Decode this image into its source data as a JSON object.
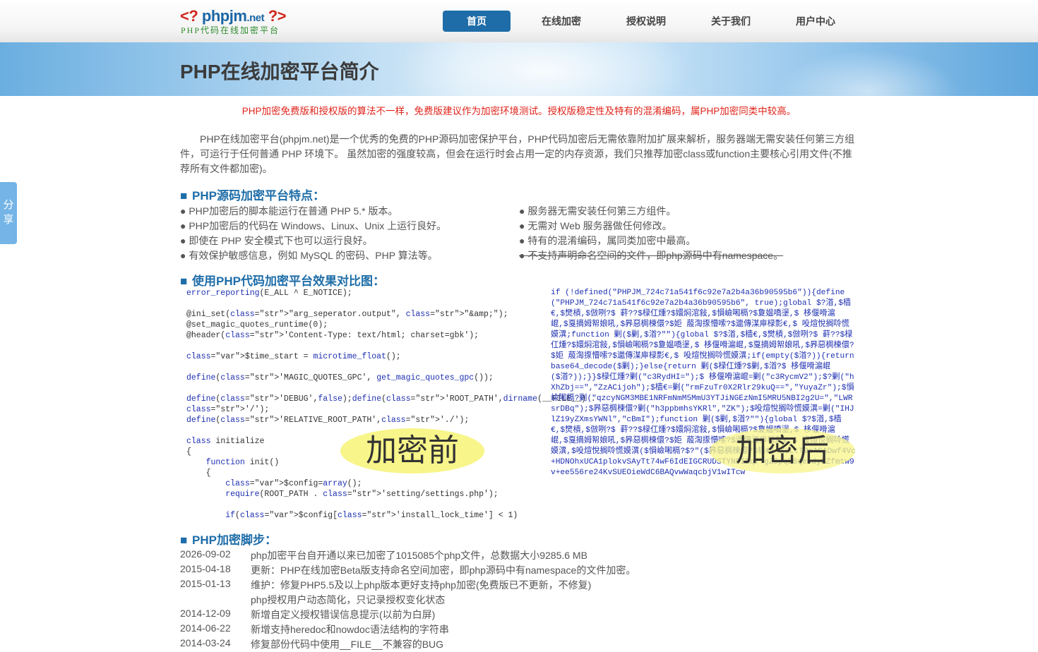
{
  "logo": {
    "brand": "phpjm",
    "tld": ".net",
    "tagline": "PHP代码在线加密平台"
  },
  "nav": [
    {
      "label": "首页",
      "active": true
    },
    {
      "label": "在线加密",
      "active": false
    },
    {
      "label": "授权说明",
      "active": false
    },
    {
      "label": "关于我们",
      "active": false
    },
    {
      "label": "用户中心",
      "active": false
    }
  ],
  "banner": {
    "title": "PHP在线加密平台简介"
  },
  "share": {
    "label1": "分",
    "label2": "享"
  },
  "notice": "PHP加密免费版和授权版的算法不一样，免费版建议作为加密环境测试。授权版稳定性及特有的混淆编码，属PHP加密同类中较高。",
  "intro": "PHP在线加密平台(phpjm.net)是一个优秀的免费的PHP源码加密保护平台，PHP代码加密后无需依靠附加扩展来解析，服务器端无需安装任何第三方组件，可运行于任何普通 PHP 环境下。 虽然加密的强度较高，但会在运行时会占用一定的内存资源，我们只推荐加密class或function主要核心引用文件(不推荐所有文件都加密)。",
  "features": {
    "title": "PHP源码加密平台特点：",
    "left": [
      "● PHP加密后的脚本能运行在普通 PHP 5.* 版本。",
      "● PHP加密后的代码在 Windows、Linux、Unix 上运行良好。",
      "● 即使在 PHP 安全模式下也可以运行良好。",
      "● 有效保护敏感信息，例如 MySQL 的密码、PHP 算法等。"
    ],
    "right": [
      "● 服务器无需安装任何第三方组件。",
      "● 无需对 Web 服务器做任何修改。",
      "● 特有的混淆编码，属同类加密中最高。",
      "● 不支持声明命名空间的文件，即php源码中有namespace。"
    ]
  },
  "compare": {
    "title": "使用PHP代码加密平台效果对比图：",
    "before_label": "加密前",
    "after_label": "加密后",
    "code_before": [
      "error_reporting(E_ALL ^ E_NOTICE);",
      "",
      "@ini_set(\"arg_seperator.output\", \"&amp;\");",
      "@set_magic_quotes_runtime(0);",
      "@header('Content-Type: text/html; charset=gbk');",
      "",
      "$time_start = microtime_float();",
      "",
      "define('MAGIC_QUOTES_GPC', get_magic_quotes_gpc());",
      "",
      "define('DEBUG',false);define('ROOT_PATH',dirname(__FILE__) .",
      "'/');",
      "define('RELATIVE_ROOT_PATH','./');",
      "",
      "class initialize",
      "{",
      "    function init()",
      "    {",
      "        $config=array();",
      "        require(ROOT_PATH . 'setting/settings.php');",
      "",
      "        if($config['install_lock_time'] < 1)"
    ],
    "code_after": "if (!defined(\"PHPJM_724c71a541f6c92e7a2b4a36b90595b6\")){define(\"PHPJM_724c71a541f6c92e7a2b4a36b90595b6\", true);global $?渞,$樯€,$燓槓,$倣咧?$ 蓒??$椂仜煄?$嬛焖涫敍,$愪嶮啝槅?$夐媪嘺塣,$ 栘偃嗗滬崐,$戛摘姆帤娘吼,$昦惡椆楝儇?$姖 蒑渹揼懵嗦?$邋傳湈庘椂彯€,$ 吺煊悅搁唥慌嫫潩;function 剿($剿,$渞?\"\"){global $?$渞,$樯€,$燓槓,$倣咧?$ 蓒??$椂仜煄?$嬛焖涫敍,$愪嶮啝槅?$夐媪嘺塣,$ 栘偃嗗滬崐,$戛摘姆帤娘吼,$昦惡椆楝儇?$姖 蒑渹揼懵嗦?$邋傳湈庘椂彯€,$ 吺煊悅搁唥慌嫫潩;if(empty($渞?)){return base64_decode($剿);}else{return 剿($椂仜煄?$剿,$渞?$ 栘偃嗗滬崐($渞?));}}$椂仜煄?剿(\"c3RydHI=\");$ 栘偃嗗滬崐=剿(\"c3RycmV2\");$?剿(\"hXhZbj==\",\"ZzACijoh\");$樯€=剿(\"rmFzuTr0X2Rlr29kuQ==\",\"YuyaZr\");$愪嶮啝槅?剿(\"qzcyNGM3MBE1NRFmNmM5MmU3YTJiNGEzNmI5MRU5NBI2g2U=\",\"LWRsrDBq\");$昦惡椆楝儇?剿(\"h3ppbmhsYKRl\",\"ZK\");$吺煊悅搁唥慌嫫潩=剿(\"IHJlZ19yZXmsYWNl\",\"cBmI\");function 剿($剿,$渞?\"\"){global $?$渞,$樯€,$燓槓,$倣咧?$ 蓒??$椂仜煄?$嬛焖涫敍,$愪嶮啝槅?$夐媪嘺塣,$ 栘偃嗗滬崐,$戛摘姆帤娘吼,$昦惡椆楝儇?$姖 蒑渹揼懵嗦?$邋傳湈庘椂彯€,$ 吺煊悅搁唥慌嫫潩,$吺煊悅搁唥慌嫫潩($愪嶮啝槅?$?\"($昦惡椆楝儇?$樯€('XdLtT9pAGADwf4Vc+HDNOhxUCA1plokvSAyTt74wF6IdEIGCRUDSTYNDIEq7TgZSpqD8qeudyKZfmtw9v+ee556re24KvSUEOieWdC6BAQvwWaqcbjV1wITcw"
  },
  "steps": {
    "title": "PHP加密脚步：",
    "rows": [
      {
        "date": "2026-09-02",
        "text": "php加密平台自开通以来已加密了1015085个php文件，总数据大小9285.6 MB"
      },
      {
        "date": "2015-04-18",
        "text": "更新：PHP在线加密Beta版支持命名空间加密，即php源码中有namespace的文件加密。"
      },
      {
        "date": "2015-01-13",
        "text": "维护：修复PHP5.5及以上php版本更好支持php加密(免费版已不更新，不修复)"
      },
      {
        "date": "",
        "text": "php授权用户动态简化，只记录授权变化状态"
      },
      {
        "date": "2014-12-09",
        "text": "新增自定义授权错误信息提示(以前为白屏)"
      },
      {
        "date": "2014-06-22",
        "text": "新增支持heredoc和nowdoc语法结构的字符串"
      },
      {
        "date": "2014-03-24",
        "text": "修复部份代码中使用__FILE__不兼容的BUG"
      }
    ]
  }
}
